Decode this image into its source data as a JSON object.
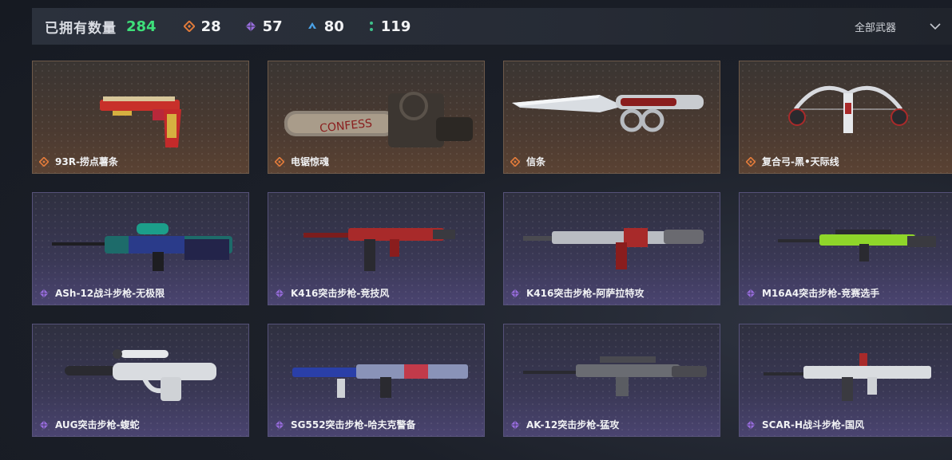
{
  "header": {
    "owned_label": "已拥有数量",
    "owned_count": "284",
    "stats": [
      {
        "icon": "orange-diamond-icon",
        "color": "#e07a3a",
        "value": "28"
      },
      {
        "icon": "purple-diamond-icon",
        "color": "#9a6ee0",
        "value": "57"
      },
      {
        "icon": "blue-triangle-icon",
        "color": "#4aa3e8",
        "value": "80"
      },
      {
        "icon": "green-dots-icon",
        "color": "#3ec08a",
        "value": "119"
      }
    ],
    "filter_label": "全部武器"
  },
  "weapons": [
    {
      "name": "93R-捞点薯条",
      "rarity": "orange",
      "icon": "orange-diamond-icon"
    },
    {
      "name": "电锯惊魂",
      "rarity": "orange",
      "icon": "orange-diamond-icon"
    },
    {
      "name": "信条",
      "rarity": "orange",
      "icon": "orange-diamond-icon"
    },
    {
      "name": "复合弓-黑•天际线",
      "rarity": "orange",
      "icon": "orange-diamond-icon"
    },
    {
      "name": "ASh-12战斗步枪-无极限",
      "rarity": "purple",
      "icon": "purple-diamond-icon"
    },
    {
      "name": "K416突击步枪-竞技风",
      "rarity": "purple",
      "icon": "purple-diamond-icon"
    },
    {
      "name": "K416突击步枪-阿萨拉特攻",
      "rarity": "purple",
      "icon": "purple-diamond-icon"
    },
    {
      "name": "M16A4突击步枪-竞赛选手",
      "rarity": "purple",
      "icon": "purple-diamond-icon"
    },
    {
      "name": "AUG突击步枪-蝮蛇",
      "rarity": "purple",
      "icon": "purple-diamond-icon"
    },
    {
      "name": "SG552突击步枪-哈夫克警备",
      "rarity": "purple",
      "icon": "purple-diamond-icon"
    },
    {
      "name": "AK-12突击步枪-猛攻",
      "rarity": "purple",
      "icon": "purple-diamond-icon"
    },
    {
      "name": "SCAR-H战斗步枪-国风",
      "rarity": "purple",
      "icon": "purple-diamond-icon"
    }
  ],
  "colors": {
    "owned_count": "#3ee07a",
    "orange_rarity": "#e07a3a",
    "purple_rarity": "#9a6ee0"
  }
}
